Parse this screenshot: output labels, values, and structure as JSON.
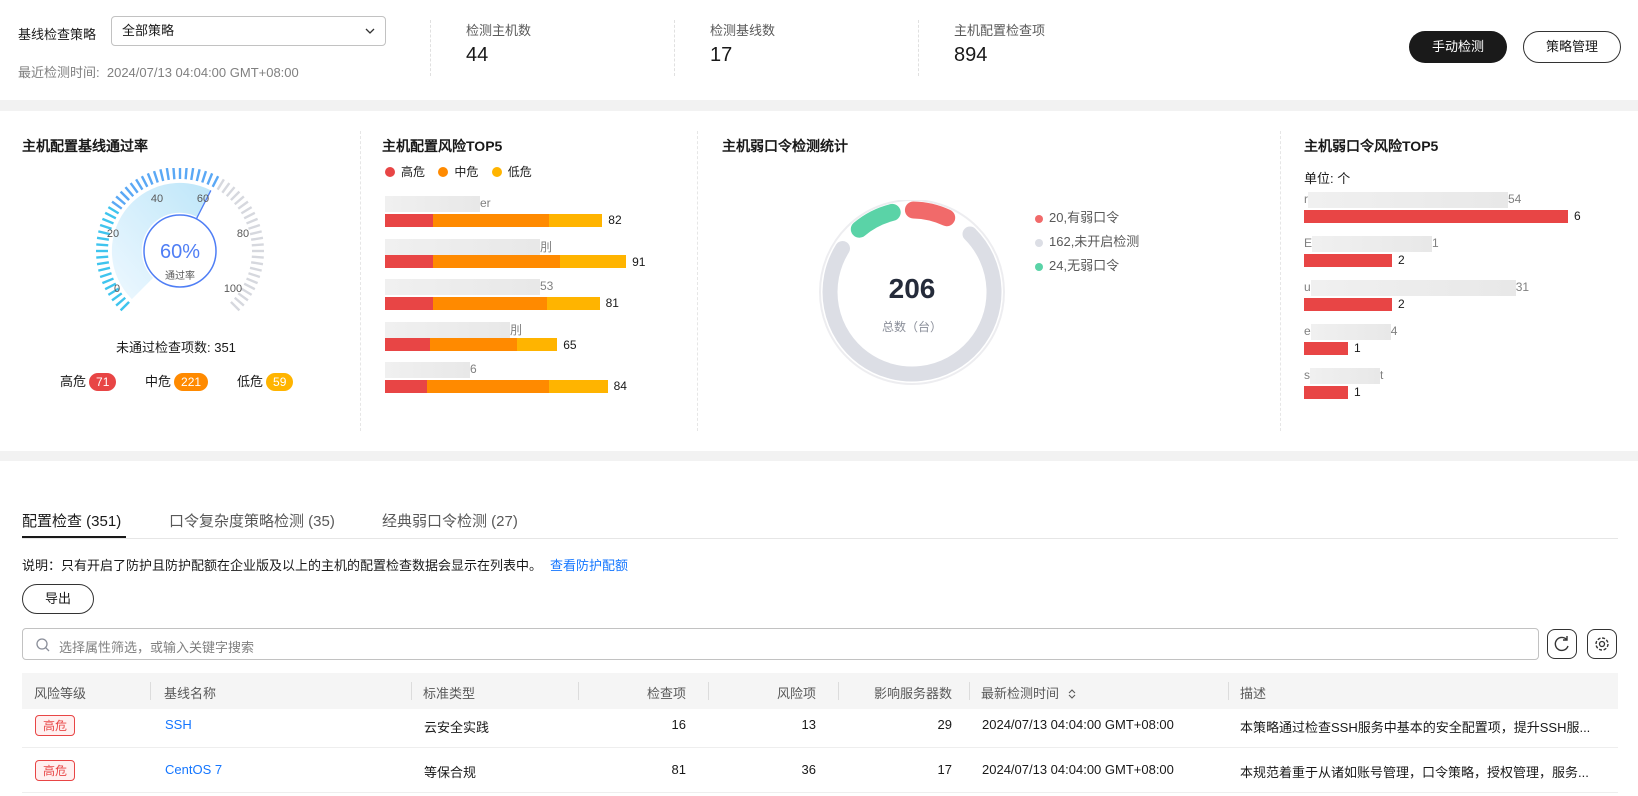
{
  "header": {
    "policy_label": "基线检查策略",
    "policy_value": "全部策略",
    "last_check_label": "最近检测时间:",
    "last_check_value": "2024/07/13 04:04:00 GMT+08:00",
    "stats": [
      {
        "label": "检测主机数",
        "value": "44"
      },
      {
        "label": "检测基线数",
        "value": "17"
      },
      {
        "label": "主机配置检查项",
        "value": "894"
      }
    ],
    "manual_check": "手动检测",
    "policy_mgmt": "策略管理"
  },
  "pass_rate": {
    "title": "主机配置基线通过率",
    "percent_text": "60%",
    "percent_value": 60,
    "center_label": "通过率",
    "ticks": [
      "0",
      "20",
      "40",
      "60",
      "80",
      "100"
    ],
    "failed_text": "未通过检查项数: 351",
    "levels": [
      {
        "label": "高危",
        "count": "71",
        "color": "#e84545"
      },
      {
        "label": "中危",
        "count": "221",
        "color": "#ff8a00"
      },
      {
        "label": "低危",
        "count": "59",
        "color": "#ffb400"
      }
    ]
  },
  "risk_top5": {
    "title": "主机配置风险TOP5",
    "legend": [
      {
        "label": "高危",
        "color": "#e84545"
      },
      {
        "label": "中危",
        "color": "#ff8a00"
      },
      {
        "label": "低危",
        "color": "#ffb400"
      }
    ],
    "items": [
      {
        "suffix": "er",
        "high": 18,
        "mid": 44,
        "low": 20,
        "total": "82"
      },
      {
        "suffix": "刖",
        "high": 18,
        "mid": 48,
        "low": 25,
        "total": "91"
      },
      {
        "suffix": "53",
        "high": 18,
        "mid": 43,
        "low": 20,
        "total": "81"
      },
      {
        "suffix": "刖",
        "high": 17,
        "mid": 33,
        "low": 15,
        "total": "65"
      },
      {
        "suffix": "6",
        "high": 16,
        "mid": 46,
        "low": 22,
        "total": "84"
      }
    ]
  },
  "weak_pwd": {
    "title": "主机弱口令检测统计",
    "total": "206",
    "total_label": "总数（台）",
    "legend": [
      {
        "label": "20,有弱口令",
        "color": "#f16a6a",
        "value": 20
      },
      {
        "label": "162,未开启检测",
        "color": "#dcdee5",
        "value": 162
      },
      {
        "label": "24,无弱口令",
        "color": "#5ad3a7",
        "value": 24
      }
    ]
  },
  "weak_top5": {
    "title": "主机弱口令风险TOP5",
    "unit": "单位: 个",
    "items": [
      {
        "prefix": "r",
        "suffix": "54",
        "value": "6",
        "num": 6
      },
      {
        "prefix": "E",
        "suffix": "1",
        "value": "2",
        "num": 2
      },
      {
        "prefix": "u",
        "suffix": "31",
        "value": "2",
        "num": 2
      },
      {
        "prefix": "e",
        "suffix": "4",
        "value": "1",
        "num": 1
      },
      {
        "prefix": "s",
        "suffix": "t",
        "value": "1",
        "num": 1
      }
    ]
  },
  "tabs": [
    {
      "label": "配置检查 (351)"
    },
    {
      "label": "口令复杂度策略检测 (35)"
    },
    {
      "label": "经典弱口令检测 (27)"
    }
  ],
  "note": {
    "text": "说明：只有开启了防护且防护配额在企业版及以上的主机的配置检查数据会显示在列表中。",
    "link": "查看防护配额"
  },
  "export_label": "导出",
  "search_placeholder": "选择属性筛选，或输入关键字搜索",
  "table": {
    "headers": [
      "风险等级",
      "基线名称",
      "标准类型",
      "检查项",
      "风险项",
      "影响服务器数",
      "最新检测时间",
      "描述"
    ],
    "rows": [
      {
        "risk": "高危",
        "name": "SSH",
        "type": "云安全实践",
        "checks": "16",
        "risks": "13",
        "servers": "29",
        "time": "2024/07/13 04:04:00 GMT+08:00",
        "desc": "本策略通过检查SSH服务中基本的安全配置项，提升SSH服..."
      },
      {
        "risk": "高危",
        "name": "CentOS 7",
        "type": "等保合规",
        "checks": "81",
        "risks": "36",
        "servers": "17",
        "time": "2024/07/13 04:04:00 GMT+08:00",
        "desc": "本规范着重于从诸如账号管理，口令策略，授权管理，服务..."
      }
    ]
  }
}
